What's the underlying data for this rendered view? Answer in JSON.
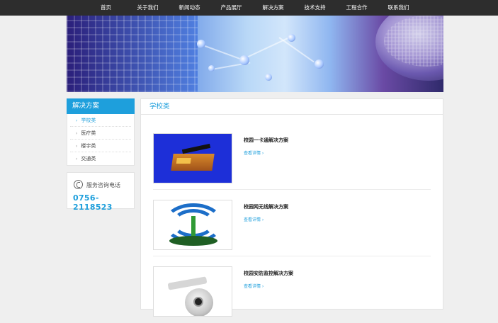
{
  "nav": {
    "items": [
      "首页",
      "关于我们",
      "新闻动态",
      "产品展厅",
      "解决方案",
      "技术支持",
      "工程合作",
      "联系我们"
    ]
  },
  "sidebar": {
    "title": "解决方案",
    "items": [
      "学校类",
      "医疗类",
      "楼宇类",
      "交通类"
    ],
    "active_index": 0,
    "phone_label": "服务咨询电话",
    "phone_number": "0756-2118523"
  },
  "main": {
    "title": "学校类",
    "products": [
      {
        "title": "校园一卡通解决方案",
        "more": "查看详情 ›",
        "icon": "smart-card-reader-image"
      },
      {
        "title": "校园网无线解决方案",
        "more": "查看详情 ›",
        "icon": "wireless-antenna-image"
      },
      {
        "title": "校园安防监控解决方案",
        "more": "查看详情 ›",
        "icon": "security-camera-image"
      }
    ]
  },
  "colors": {
    "accent": "#1e9fdc",
    "nav_bg": "#2d2d2d",
    "page_bg": "#efefef"
  }
}
